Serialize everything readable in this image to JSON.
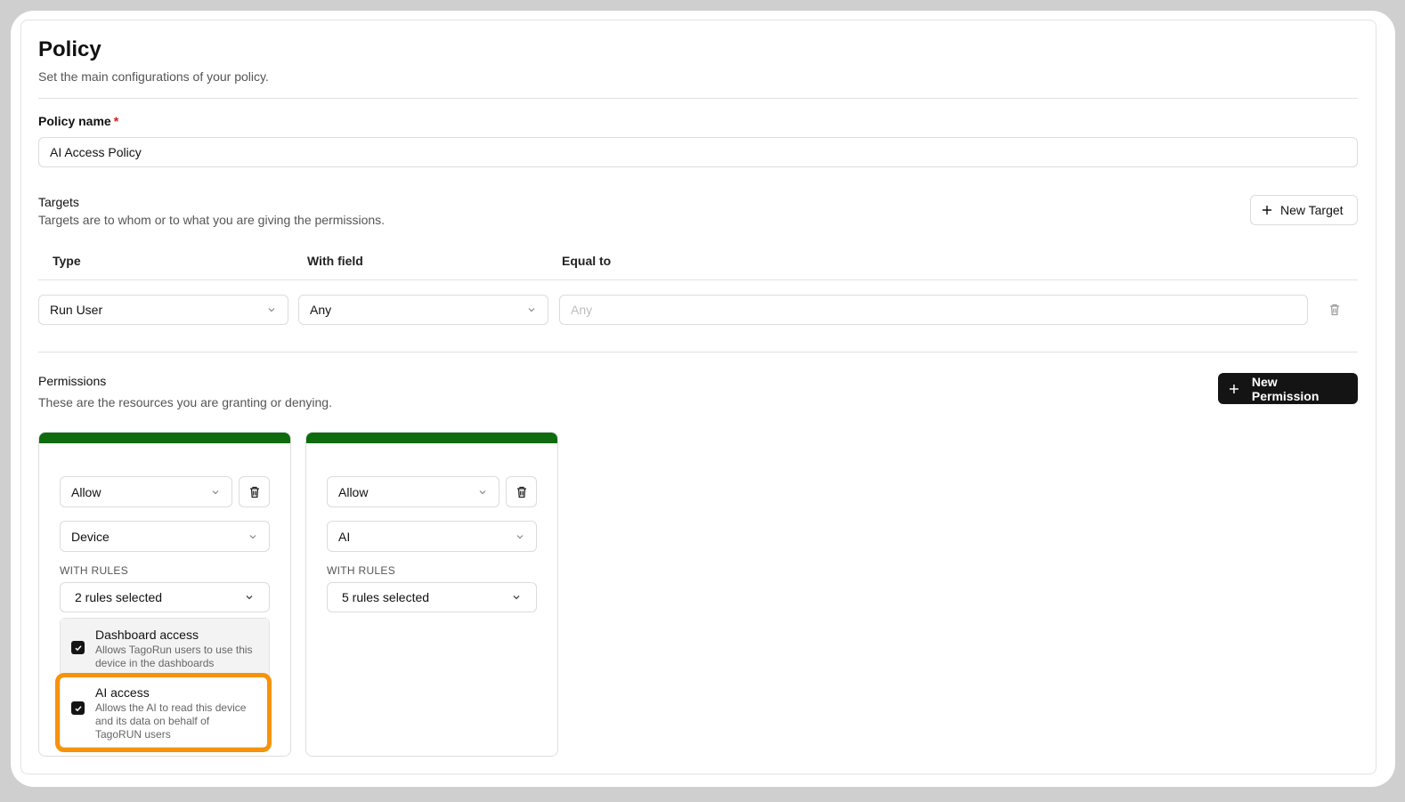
{
  "header": {
    "title": "Policy",
    "subtitle": "Set the main configurations of your policy."
  },
  "policy_name": {
    "label": "Policy name",
    "required_mark": "*",
    "value": "AI Access Policy"
  },
  "targets": {
    "title": "Targets",
    "subtitle": "Targets are to whom or to what you are giving the permissions.",
    "new_button": "New Target",
    "columns": [
      "Type",
      "With field",
      "Equal to"
    ],
    "row": {
      "type": "Run User",
      "with_field": "Any",
      "equal_to_placeholder": "Any"
    }
  },
  "permissions": {
    "title": "Permissions",
    "subtitle": "These are the resources you are granting or denying.",
    "new_button": "New Permission",
    "accent_color": "#0e6b0e",
    "cards": [
      {
        "effect": "Allow",
        "resource": "Device",
        "rules_label": "WITH RULES",
        "rules_summary": "2 rules selected",
        "options": [
          {
            "title": "Dashboard access",
            "description": "Allows TagoRun users to use this device in the dashboards",
            "checked": true
          },
          {
            "title": "AI access",
            "description": "Allows the AI to read this device and its data on behalf of TagoRUN users",
            "checked": true
          }
        ]
      },
      {
        "effect": "Allow",
        "resource": "AI",
        "rules_label": "WITH RULES",
        "rules_summary": "5 rules selected"
      }
    ]
  },
  "highlight_color": "#f5930b",
  "icons": [
    "plus-icon",
    "chevron-down-icon",
    "trash-icon",
    "check-icon"
  ]
}
